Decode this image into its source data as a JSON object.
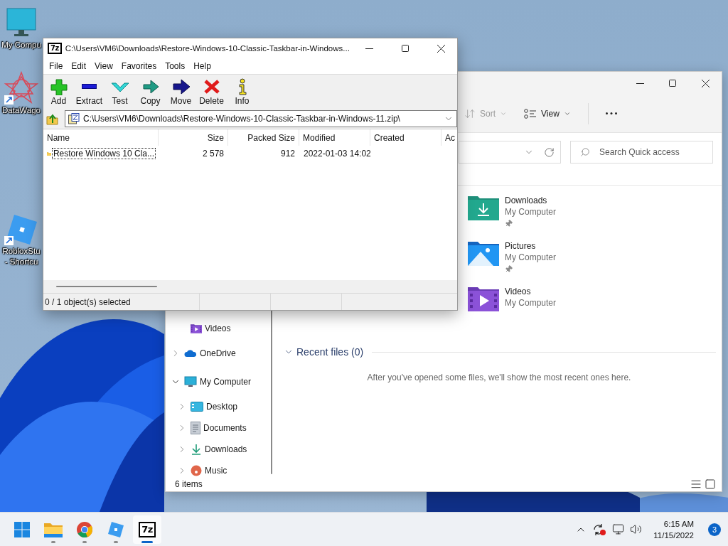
{
  "desktop_icons": [
    {
      "kind": "computer",
      "lines": [
        "My Compu"
      ],
      "shortcut": false
    },
    {
      "kind": "datawagon",
      "lines": [
        "DataWago"
      ],
      "shortcut": true
    },
    {
      "kind": "roblox",
      "lines": [
        "RobloxStu",
        "- Shortcu"
      ],
      "shortcut": true
    }
  ],
  "explorer": {
    "toolbar": [
      {
        "label": "Sort",
        "kind": "sort",
        "disabled": true
      },
      {
        "label": "View",
        "kind": "view",
        "disabled": false
      }
    ],
    "search_placeholder": "Search Quick access",
    "quick_access": [
      {
        "name": "Downloads",
        "location": "My Computer",
        "kind": "downloads",
        "pinned": true
      },
      {
        "name": "Pictures",
        "location": "My Computer",
        "kind": "pictures",
        "pinned": true
      },
      {
        "name": "Videos",
        "location": "My Computer",
        "kind": "videos",
        "pinned": false
      }
    ],
    "nav": [
      {
        "children": [
          {
            "label": "Videos",
            "kind": "videos"
          }
        ]
      },
      {
        "label": "OneDrive",
        "kind": "onedrive",
        "expanded": false
      },
      {
        "label": "My Computer",
        "kind": "computer",
        "expanded": true,
        "children": [
          {
            "label": "Desktop",
            "kind": "desktop",
            "expanded": false
          },
          {
            "label": "Documents",
            "kind": "documents",
            "expanded": false
          },
          {
            "label": "Downloads",
            "kind": "downloads",
            "expanded": false
          },
          {
            "label": "Music",
            "kind": "music",
            "expanded": false
          }
        ]
      }
    ],
    "recent": {
      "title": "Recent files (0)",
      "expanded": true,
      "message": "After you've opened some files, we'll show the most recent ones here."
    },
    "status": "6 items"
  },
  "sevenzip": {
    "icon_text": "7z",
    "title": "C:\\Users\\VM6\\Downloads\\Restore-Windows-10-Classic-Taskbar-in-Windows...",
    "menu": [
      "File",
      "Edit",
      "View",
      "Favorites",
      "Tools",
      "Help"
    ],
    "toolbar": [
      {
        "label": "Add",
        "kind": "add"
      },
      {
        "label": "Extract",
        "kind": "extract"
      },
      {
        "label": "Test",
        "kind": "test"
      },
      {
        "label": "Copy",
        "kind": "copy"
      },
      {
        "label": "Move",
        "kind": "move"
      },
      {
        "label": "Delete",
        "kind": "delete"
      },
      {
        "label": "Info",
        "kind": "info"
      }
    ],
    "path": "C:\\Users\\VM6\\Downloads\\Restore-Windows-10-Classic-Taskbar-in-Windows-11.zip\\",
    "columns": [
      {
        "label": "Name"
      },
      {
        "label": "Size"
      },
      {
        "label": "Packed Size"
      },
      {
        "label": "Modified"
      },
      {
        "label": "Created"
      },
      {
        "label": "Ac"
      }
    ],
    "rows": [
      {
        "cells": [
          "Restore Windows 10 Cla...",
          "2 578",
          "912",
          "2022-01-03 14:02"
        ],
        "focused": true
      }
    ],
    "status": "0 / 1 object(s) selected"
  },
  "taskbar": {
    "apps": [
      {
        "kind": "start",
        "running": false,
        "active": false
      },
      {
        "kind": "explorer",
        "running": true,
        "active": false
      },
      {
        "kind": "chrome",
        "running": true,
        "active": false
      },
      {
        "kind": "roblox",
        "running": true,
        "active": false
      },
      {
        "kind": "sevenzip",
        "label": "7z",
        "running": true,
        "active": true
      }
    ],
    "time": "6:15 AM",
    "date": "11/15/2022",
    "notifications": "3"
  }
}
